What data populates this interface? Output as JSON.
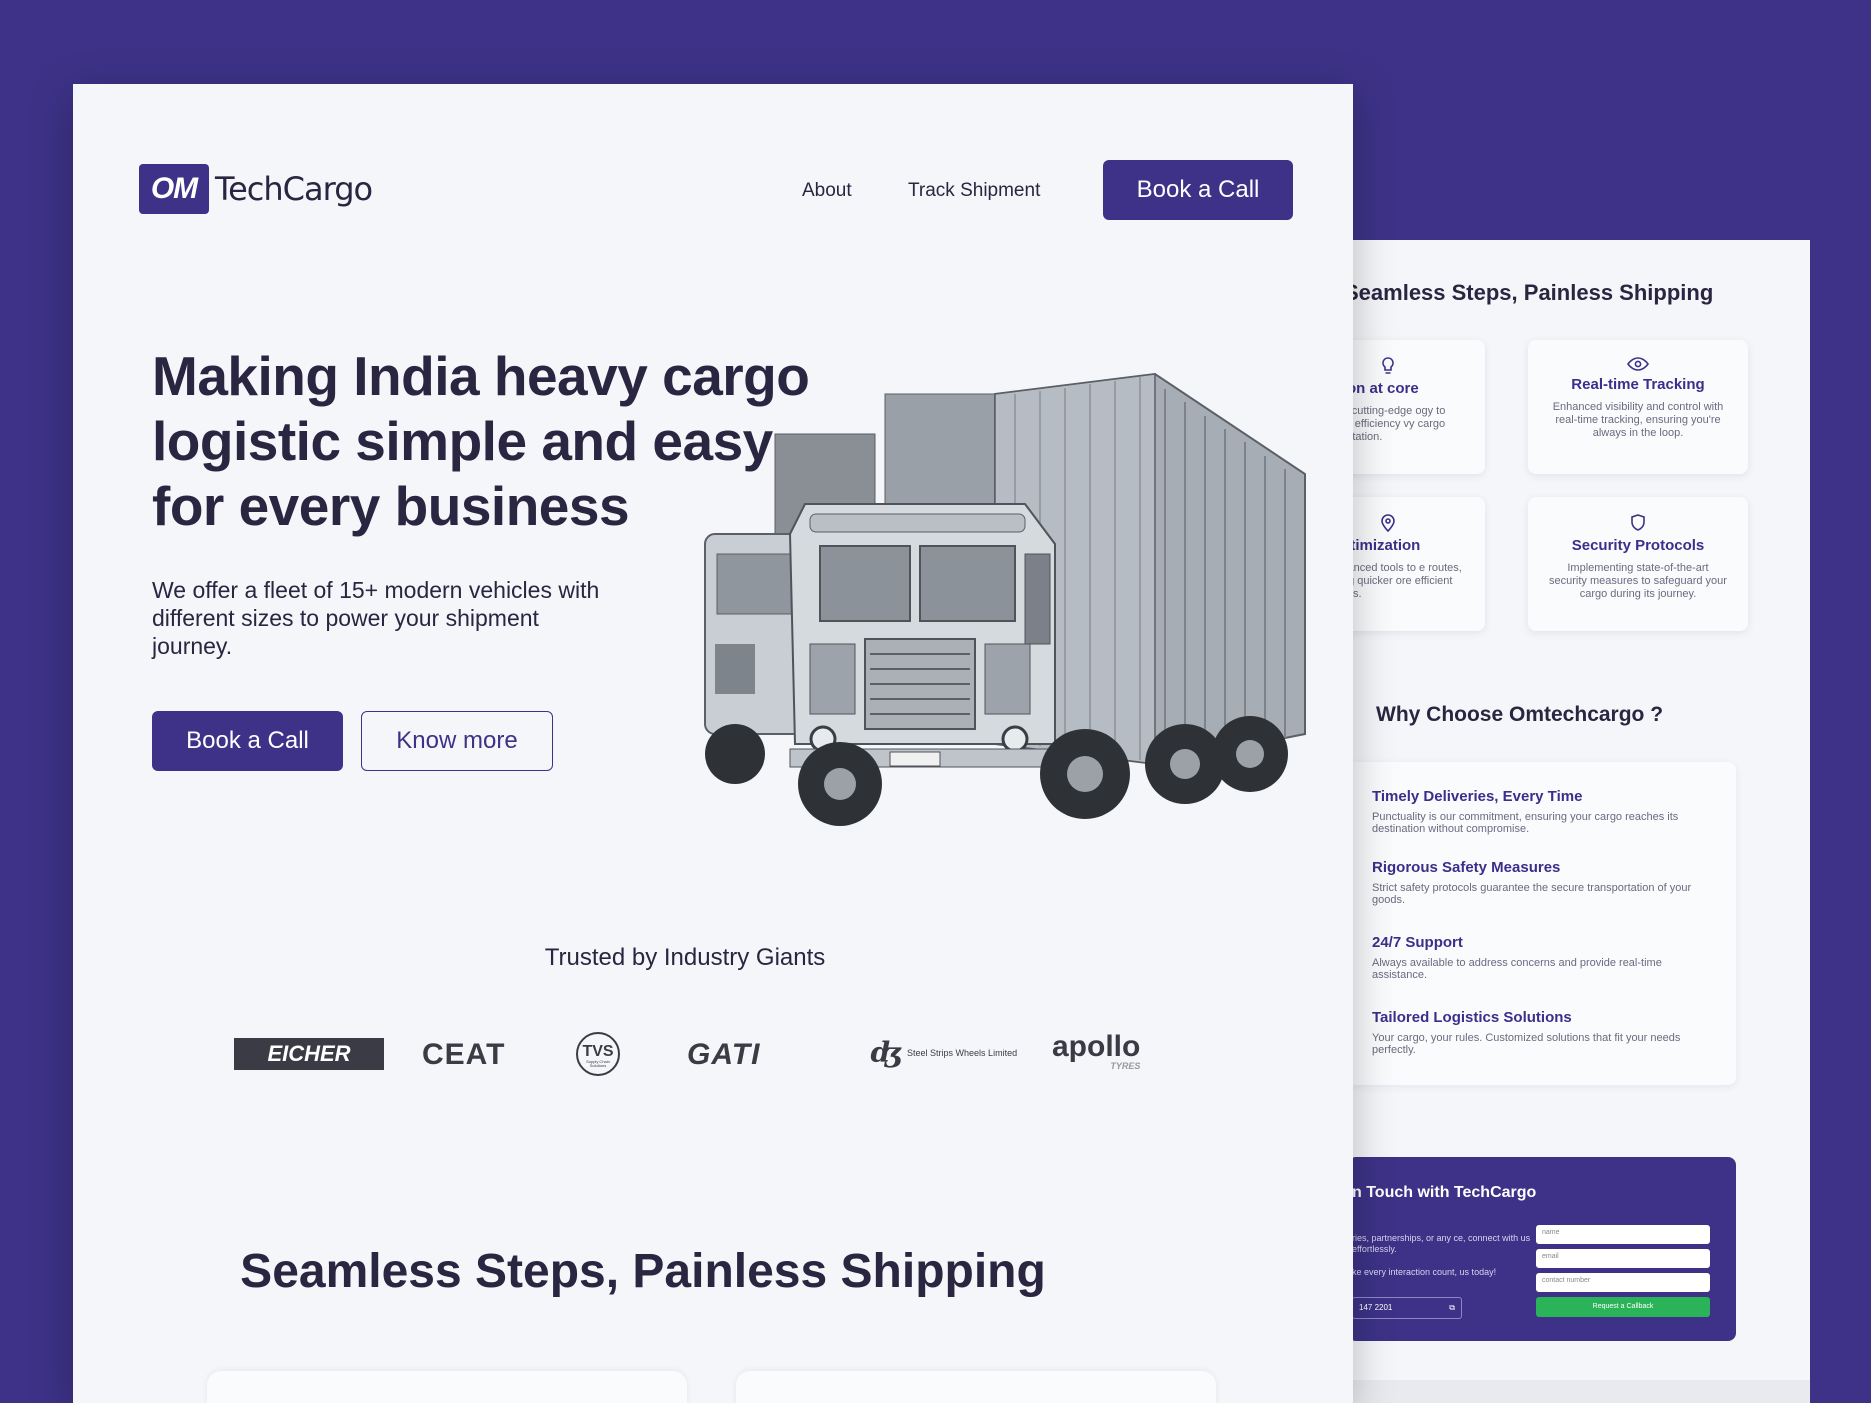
{
  "colors": {
    "brand": "#3d3287",
    "accent_green": "#2bb35a",
    "page_bg": "#f5f6f9",
    "text": "#2a2540"
  },
  "header": {
    "logo_mark": "OM",
    "logo_text": "TechCargo",
    "nav": {
      "about": "About",
      "track": "Track Shipment"
    },
    "cta": "Book a Call"
  },
  "hero": {
    "title_lines": [
      "Making India heavy cargo",
      "logistic simple and easy",
      "for every business"
    ],
    "subtitle": "We offer a fleet of 15+ modern vehicles with different sizes to power your shipment journey.",
    "primary_button": "Book a Call",
    "secondary_button": "Know more",
    "image": "cargo-truck-illustration"
  },
  "trusted": {
    "heading": "Trusted by Industry Giants",
    "logos": [
      "EICHER",
      "CEAT",
      "TVS",
      "GATI",
      "Steel Strips Wheels Limited",
      "apollo"
    ],
    "logo_sub": {
      "tvs": "Supply Chain Solutions",
      "apollo": "TYRES"
    }
  },
  "steps": {
    "heading": "Seamless Steps, Painless Shipping"
  },
  "back_page": {
    "steps_heading": "Seamless Steps, Painless Shipping",
    "features": [
      {
        "icon": "lightbulb-icon",
        "title": "ovation at core",
        "desc": "eraging cutting-edge ogy to redefine efficiency vy cargo transportation."
      },
      {
        "icon": "eye-icon",
        "title": "Real-time Tracking",
        "desc": "Enhanced visibility and control with real-time tracking, ensuring you're always in the loop."
      },
      {
        "icon": "map-pin-icon",
        "title": "te Optimization",
        "desc": "ing advanced tools to e routes, ensuring quicker ore efficient deliveries."
      },
      {
        "icon": "shield-icon",
        "title": "Security Protocols",
        "desc": "Implementing state-of-the-art security measures to safeguard your cargo during its journey."
      }
    ],
    "why_heading": "Why Choose Omtechcargo ?",
    "why_items": [
      {
        "title": "Timely Deliveries, Every Time",
        "desc": "Punctuality is our commitment, ensuring your cargo reaches its destination without compromise."
      },
      {
        "title": "Rigorous Safety Measures",
        "desc": "Strict safety protocols guarantee the secure transportation of your goods."
      },
      {
        "title": "24/7 Support",
        "desc": "Always available to address concerns and provide real-time assistance."
      },
      {
        "title": "Tailored Logistics Solutions",
        "desc": "Your cargo, your rules. Customized solutions that fit your needs perfectly."
      }
    ],
    "contact": {
      "title": "n Touch with TechCargo",
      "desc": "ries, partnerships, or any ce, connect with us effortlessly.",
      "desc2": "ke every interaction count, us today!",
      "phone": "147 2201",
      "name_placeholder": "name",
      "email_placeholder": "email",
      "phone_placeholder": "contact number",
      "submit": "Request a Callback"
    }
  }
}
